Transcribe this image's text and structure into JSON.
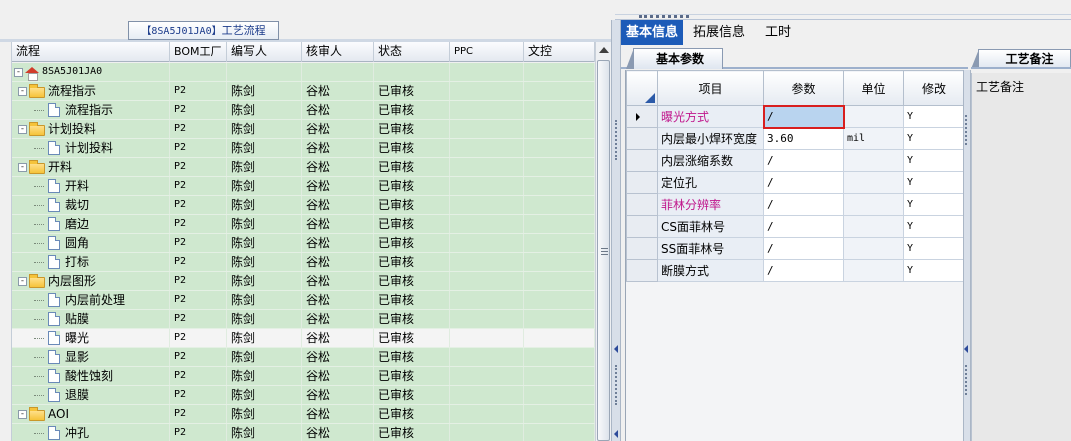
{
  "left_panel": {
    "title_code": "【8SA5J01JA0】",
    "title_text": "工艺流程",
    "columns": [
      "流程",
      "BOM工厂",
      "编写人",
      "核审人",
      "状态",
      "PPC",
      "文控"
    ],
    "rows": [
      {
        "name": "8SA5J01JA0",
        "type": "root",
        "level": 0,
        "expander": "-",
        "bom": "",
        "writer": "",
        "reviewer": "",
        "status": ""
      },
      {
        "name": "流程指示",
        "type": "folder",
        "level": 1,
        "expander": "-",
        "bom": "P2",
        "writer": "陈剑",
        "reviewer": "谷松",
        "status": "已审核"
      },
      {
        "name": "流程指示",
        "type": "doc",
        "level": 2,
        "bom": "P2",
        "writer": "陈剑",
        "reviewer": "谷松",
        "status": "已审核"
      },
      {
        "name": "计划投料",
        "type": "folder",
        "level": 1,
        "expander": "-",
        "bom": "P2",
        "writer": "陈剑",
        "reviewer": "谷松",
        "status": "已审核"
      },
      {
        "name": "计划投料",
        "type": "doc",
        "level": 2,
        "bom": "P2",
        "writer": "陈剑",
        "reviewer": "谷松",
        "status": "已审核"
      },
      {
        "name": "开料",
        "type": "folder",
        "level": 1,
        "expander": "-",
        "bom": "P2",
        "writer": "陈剑",
        "reviewer": "谷松",
        "status": "已审核"
      },
      {
        "name": "开料",
        "type": "doc",
        "level": 2,
        "bom": "P2",
        "writer": "陈剑",
        "reviewer": "谷松",
        "status": "已审核"
      },
      {
        "name": "裁切",
        "type": "doc",
        "level": 2,
        "bom": "P2",
        "writer": "陈剑",
        "reviewer": "谷松",
        "status": "已审核"
      },
      {
        "name": "磨边",
        "type": "doc",
        "level": 2,
        "bom": "P2",
        "writer": "陈剑",
        "reviewer": "谷松",
        "status": "已审核"
      },
      {
        "name": "圆角",
        "type": "doc",
        "level": 2,
        "bom": "P2",
        "writer": "陈剑",
        "reviewer": "谷松",
        "status": "已审核"
      },
      {
        "name": "打标",
        "type": "doc",
        "level": 2,
        "bom": "P2",
        "writer": "陈剑",
        "reviewer": "谷松",
        "status": "已审核"
      },
      {
        "name": "内层图形",
        "type": "folder",
        "level": 1,
        "expander": "-",
        "bom": "P2",
        "writer": "陈剑",
        "reviewer": "谷松",
        "status": "已审核"
      },
      {
        "name": "内层前处理",
        "type": "doc",
        "level": 2,
        "bom": "P2",
        "writer": "陈剑",
        "reviewer": "谷松",
        "status": "已审核"
      },
      {
        "name": "贴膜",
        "type": "doc",
        "level": 2,
        "bom": "P2",
        "writer": "陈剑",
        "reviewer": "谷松",
        "status": "已审核"
      },
      {
        "name": "曝光",
        "type": "doc",
        "level": 2,
        "bom": "P2",
        "writer": "陈剑",
        "reviewer": "谷松",
        "status": "已审核",
        "selected": true
      },
      {
        "name": "显影",
        "type": "doc",
        "level": 2,
        "bom": "P2",
        "writer": "陈剑",
        "reviewer": "谷松",
        "status": "已审核"
      },
      {
        "name": "酸性蚀刻",
        "type": "doc",
        "level": 2,
        "bom": "P2",
        "writer": "陈剑",
        "reviewer": "谷松",
        "status": "已审核"
      },
      {
        "name": "退膜",
        "type": "doc",
        "level": 2,
        "bom": "P2",
        "writer": "陈剑",
        "reviewer": "谷松",
        "status": "已审核"
      },
      {
        "name": "AOI",
        "type": "folder",
        "level": 1,
        "expander": "-",
        "bom": "P2",
        "writer": "陈剑",
        "reviewer": "谷松",
        "status": "已审核"
      },
      {
        "name": "冲孔",
        "type": "doc",
        "level": 2,
        "bom": "P2",
        "writer": "陈剑",
        "reviewer": "谷松",
        "status": "已审核"
      }
    ]
  },
  "right_panel": {
    "tabs": [
      "基本信息",
      "拓展信息",
      "工时"
    ],
    "active_tab": 0,
    "inner_tab": "基本参数",
    "grid_headers": [
      "项目",
      "参数",
      "单位",
      "修改"
    ],
    "params": [
      {
        "item": "曝光方式",
        "value": "/",
        "unit": "",
        "modify": "Y",
        "highlight": true,
        "current": true
      },
      {
        "item": "内层最小焊环宽度",
        "value": "3.60",
        "unit": "mil",
        "modify": "Y",
        "highlight": false
      },
      {
        "item": "内层涨缩系数",
        "value": "/",
        "unit": "",
        "modify": "Y",
        "highlight": false
      },
      {
        "item": "定位孔",
        "value": "/",
        "unit": "",
        "modify": "Y",
        "highlight": false
      },
      {
        "item": "菲林分辨率",
        "value": "/",
        "unit": "",
        "modify": "Y",
        "highlight": true
      },
      {
        "item": "CS面菲林号",
        "value": "/",
        "unit": "",
        "modify": "Y",
        "highlight": false
      },
      {
        "item": "SS面菲林号",
        "value": "/",
        "unit": "",
        "modify": "Y",
        "highlight": false
      },
      {
        "item": "断膜方式",
        "value": "/",
        "unit": "",
        "modify": "Y",
        "highlight": false
      }
    ],
    "remarks_tab": "工艺备注",
    "remarks_label": "工艺备注"
  },
  "colors": {
    "tree_bg": "#cfe8cf",
    "active_tab": "#1c5bb8",
    "highlight_text": "#c0168c",
    "focus_outline": "#d81e1e"
  }
}
